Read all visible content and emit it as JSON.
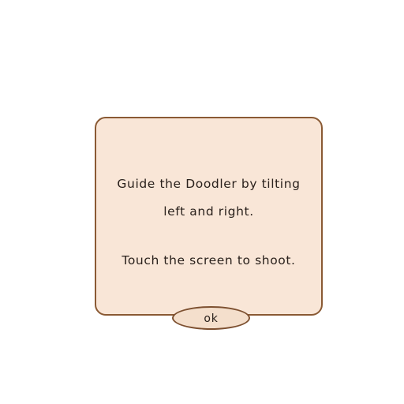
{
  "dialog": {
    "lines": [
      "Guide the Doodler by tilting",
      "left and right.",
      "Touch the screen to shoot."
    ]
  },
  "ok_button": {
    "label": "ok"
  },
  "colors": {
    "background": "#ffffff",
    "dialog_fill": "#f9e6d7",
    "dialog_border": "#8a5a34",
    "text": "#2a211c"
  }
}
